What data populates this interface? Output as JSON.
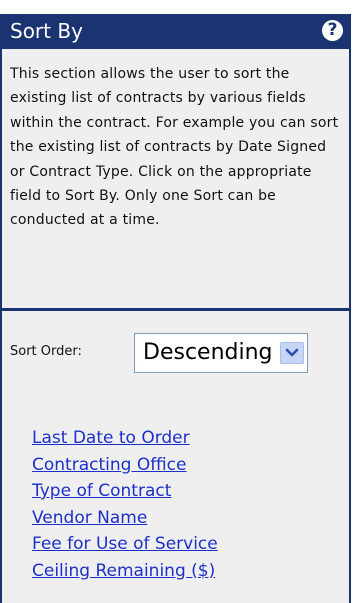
{
  "panel": {
    "title": "Sort By",
    "help_icon": "question-mark-icon",
    "description": "This section allows the user to sort the existing list of contracts by various fields within the contract. For example you can sort the existing list of contracts by Date Signed or Contract Type. Click on the appropriate field to Sort By. Only one Sort can be conducted at a time."
  },
  "sort_order": {
    "label": "Sort Order:",
    "selected": "Descending",
    "arrow_icon": "chevron-down-icon"
  },
  "sort_fields": [
    "Last Date to Order",
    "Contracting Office",
    "Type of Contract",
    "Vendor Name",
    "Fee for Use of Service",
    "Ceiling Remaining ($)"
  ],
  "colors": {
    "header_bg": "#1b3471",
    "panel_bg": "#f0efef",
    "link": "#1c30c9"
  }
}
